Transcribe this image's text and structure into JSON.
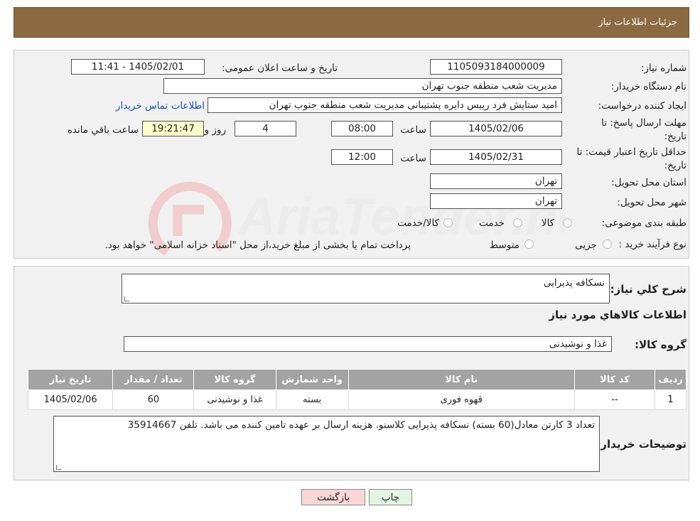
{
  "header": {
    "title": "جزئیات اطلاعات نیاز"
  },
  "form": {
    "need_number_label": "شماره نیاز:",
    "need_number": "1105093184000009",
    "announce_label": "تاریخ و ساعت اعلان عمومی:",
    "announce_value": "1405/02/01 - 11:41",
    "buyer_org_label": "نام دستگاه خریدار:",
    "buyer_org": "مدیریت شعب منطقه جنوب تهران",
    "requester_label": "ایجاد کننده درخواست:",
    "requester": "امید ستایش فرد رییس دایره پشتیبانی مدیریت شعب منطقه جنوب تهران",
    "contact_link": "اطلاعات تماس خریدار",
    "reply_deadline_label": "مهلت ارسال پاسخ: تا تاریخ:",
    "reply_date": "1405/02/06",
    "time_label": "ساعت",
    "reply_time": "08:00",
    "days": "4",
    "days_label": "روز و",
    "remaining": "19:21:47",
    "remaining_label": "ساعت باقي مانده",
    "validity_label": "حداقل تاریخ اعتبار قیمت: تا تاریخ:",
    "validity_date": "1405/02/31",
    "validity_time": "12:00",
    "province_label": "استان محل تحویل:",
    "province": "تهران",
    "city_label": "شهر محل تحویل:",
    "city": "تهران",
    "category_label": "طبقه بندی موضوعی:",
    "category_options": [
      "کالا",
      "خدمت",
      "کالا/خدمت"
    ],
    "process_label": "نوع فرآیند خرید :",
    "process_options": [
      "جزیی",
      "متوسط"
    ],
    "process_note": "پرداخت تمام یا بخشی از مبلغ خرید،از محل \"اسناد خزانه اسلامی\" خواهد بود."
  },
  "watermark": {
    "text": "AriaTender.neT"
  },
  "details": {
    "summary_label": "شرح كلي نياز:",
    "summary": "نسکافه پذیرایی",
    "goods_heading": "اطلاعات كالاهاي مورد نياز",
    "group_label": "گروه کالا:",
    "group": "غذا و نوشیدنی",
    "table": {
      "headers": [
        "رديف",
        "كد كالا",
        "نام كالا",
        "واحد شمارش",
        "گروه كالا",
        "تعداد / مقدار",
        "تاريخ نياز"
      ],
      "rows": [
        [
          "1",
          "--",
          "قهوه فوری",
          "بسته",
          "غذا و نوشیدنی",
          "60",
          "1405/02/06"
        ]
      ]
    },
    "buyer_notes_label": "توضیحات خریدار:",
    "buyer_notes": "تعداد 3 کارتن معادل(60 بسته) نسکافه پذیرایی کلاسنو. هزینه ارسال بر عهده تامین کننده می باشد. تلفن 35914667"
  },
  "buttons": {
    "print": "چاپ",
    "back": "بازگشت"
  },
  "colors": {
    "header": "#8b6a42",
    "yellow": "#ffffcc",
    "back_button": "#f9d7d7",
    "print_button": "#e3f5e3"
  }
}
